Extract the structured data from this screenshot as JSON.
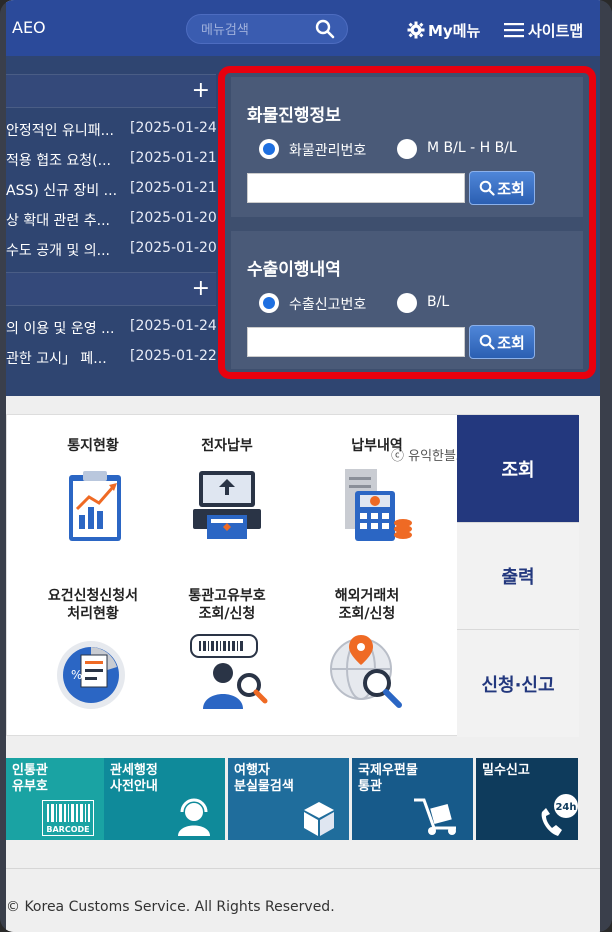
{
  "header": {
    "logo_text": "AEO",
    "search_placeholder": "메뉴검색",
    "mymenu_label": "My메뉴",
    "sitemap_label": "사이트맵"
  },
  "news": {
    "list1": [
      {
        "title": "안정적인 유니패...",
        "date": "[2025-01-24]"
      },
      {
        "title": "적용 협조 요청(...",
        "date": "[2025-01-21]"
      },
      {
        "title": "ASS) 신규 장비 ...",
        "date": "[2025-01-21]"
      },
      {
        "title": "상 확대 관련 추...",
        "date": "[2025-01-20]"
      },
      {
        "title": "수도 공개 및 의...",
        "date": "[2025-01-20]"
      }
    ],
    "list2": [
      {
        "title": "의 이용 및 운영 ...",
        "date": "[2025-01-24]"
      },
      {
        "title": "관한 고시」 폐...",
        "date": "[2025-01-22]"
      }
    ],
    "more_symbol": "+"
  },
  "cargo": {
    "title": "화물진행정보",
    "radio1": "화물관리번호",
    "radio2": "M B/L - H B/L",
    "button": "조회"
  },
  "export": {
    "title": "수출이행내역",
    "radio1": "수출신고번호",
    "radio2": "B/L",
    "button": "조회"
  },
  "services": {
    "items": [
      {
        "label": "통지현황",
        "icon": "clipboard-chart-icon"
      },
      {
        "label": "전자납부",
        "icon": "card-payment-icon"
      },
      {
        "label": "납부내역",
        "icon": "receipt-calculator-icon"
      },
      {
        "label_line1": "요건신청신청서",
        "label_line2": "처리현황",
        "icon": "pie-document-icon"
      },
      {
        "label_line1": "통관고유부호",
        "label_line2": "조회/신청",
        "icon": "person-barcode-icon"
      },
      {
        "label_line1": "해외거래처",
        "label_line2": "조회/신청",
        "icon": "globe-search-icon"
      }
    ],
    "watermark": "ⓒ 유익한블로그",
    "tabs": [
      "조회",
      "출력",
      "신청·신고"
    ]
  },
  "tiles": [
    {
      "line1": "인통관",
      "line2": "유부호",
      "badge": "BARCODE",
      "color": "#1aa3a3"
    },
    {
      "line1": "관세행정",
      "line2": "사전안내",
      "color": "#0f8a9a"
    },
    {
      "line1": "여행자",
      "line2": "분실물검색",
      "color": "#1f6d9c"
    },
    {
      "line1": "국제우편물",
      "line2": "통관",
      "color": "#175a8a"
    },
    {
      "line1": "밀수신고",
      "line2": "",
      "badge": "24h",
      "color": "#0e3b5c"
    }
  ],
  "footer": {
    "copyright": "© Korea Customs Service. All Rights Reserved."
  }
}
